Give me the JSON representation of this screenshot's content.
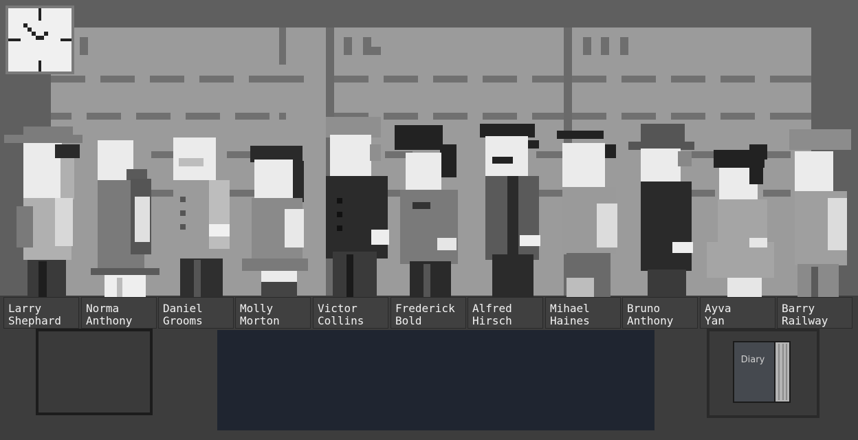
{
  "suspects": [
    {
      "id": "larry",
      "first": "Larry",
      "last": "Shephard"
    },
    {
      "id": "norma",
      "first": "Norma",
      "last": "Anthony"
    },
    {
      "id": "daniel",
      "first": "Daniel",
      "last": "Grooms"
    },
    {
      "id": "molly",
      "first": "Molly",
      "last": "Morton"
    },
    {
      "id": "victor",
      "first": "Victor",
      "last": "Collins"
    },
    {
      "id": "frederick",
      "first": "Frederick",
      "last": "Bold"
    },
    {
      "id": "alfred",
      "first": "Alfred",
      "last": "Hirsch"
    },
    {
      "id": "mihael",
      "first": "Mihael",
      "last": "Haines"
    },
    {
      "id": "bruno",
      "first": "Bruno",
      "last": "Anthony"
    },
    {
      "id": "ayva",
      "first": "Ayva",
      "last": "Yan"
    },
    {
      "id": "barry",
      "first": "Barry",
      "last": "Railway"
    }
  ],
  "diary": {
    "label": "Diary"
  },
  "colors": {
    "wall": "#5f5f5f",
    "lineup_board": "#9a9a9a",
    "floor": "#3d3d3d",
    "desk": "#1f2530",
    "nametag": "#404040"
  },
  "icons": {
    "clock": "wall-clock-icon",
    "diary": "diary-book-icon"
  }
}
